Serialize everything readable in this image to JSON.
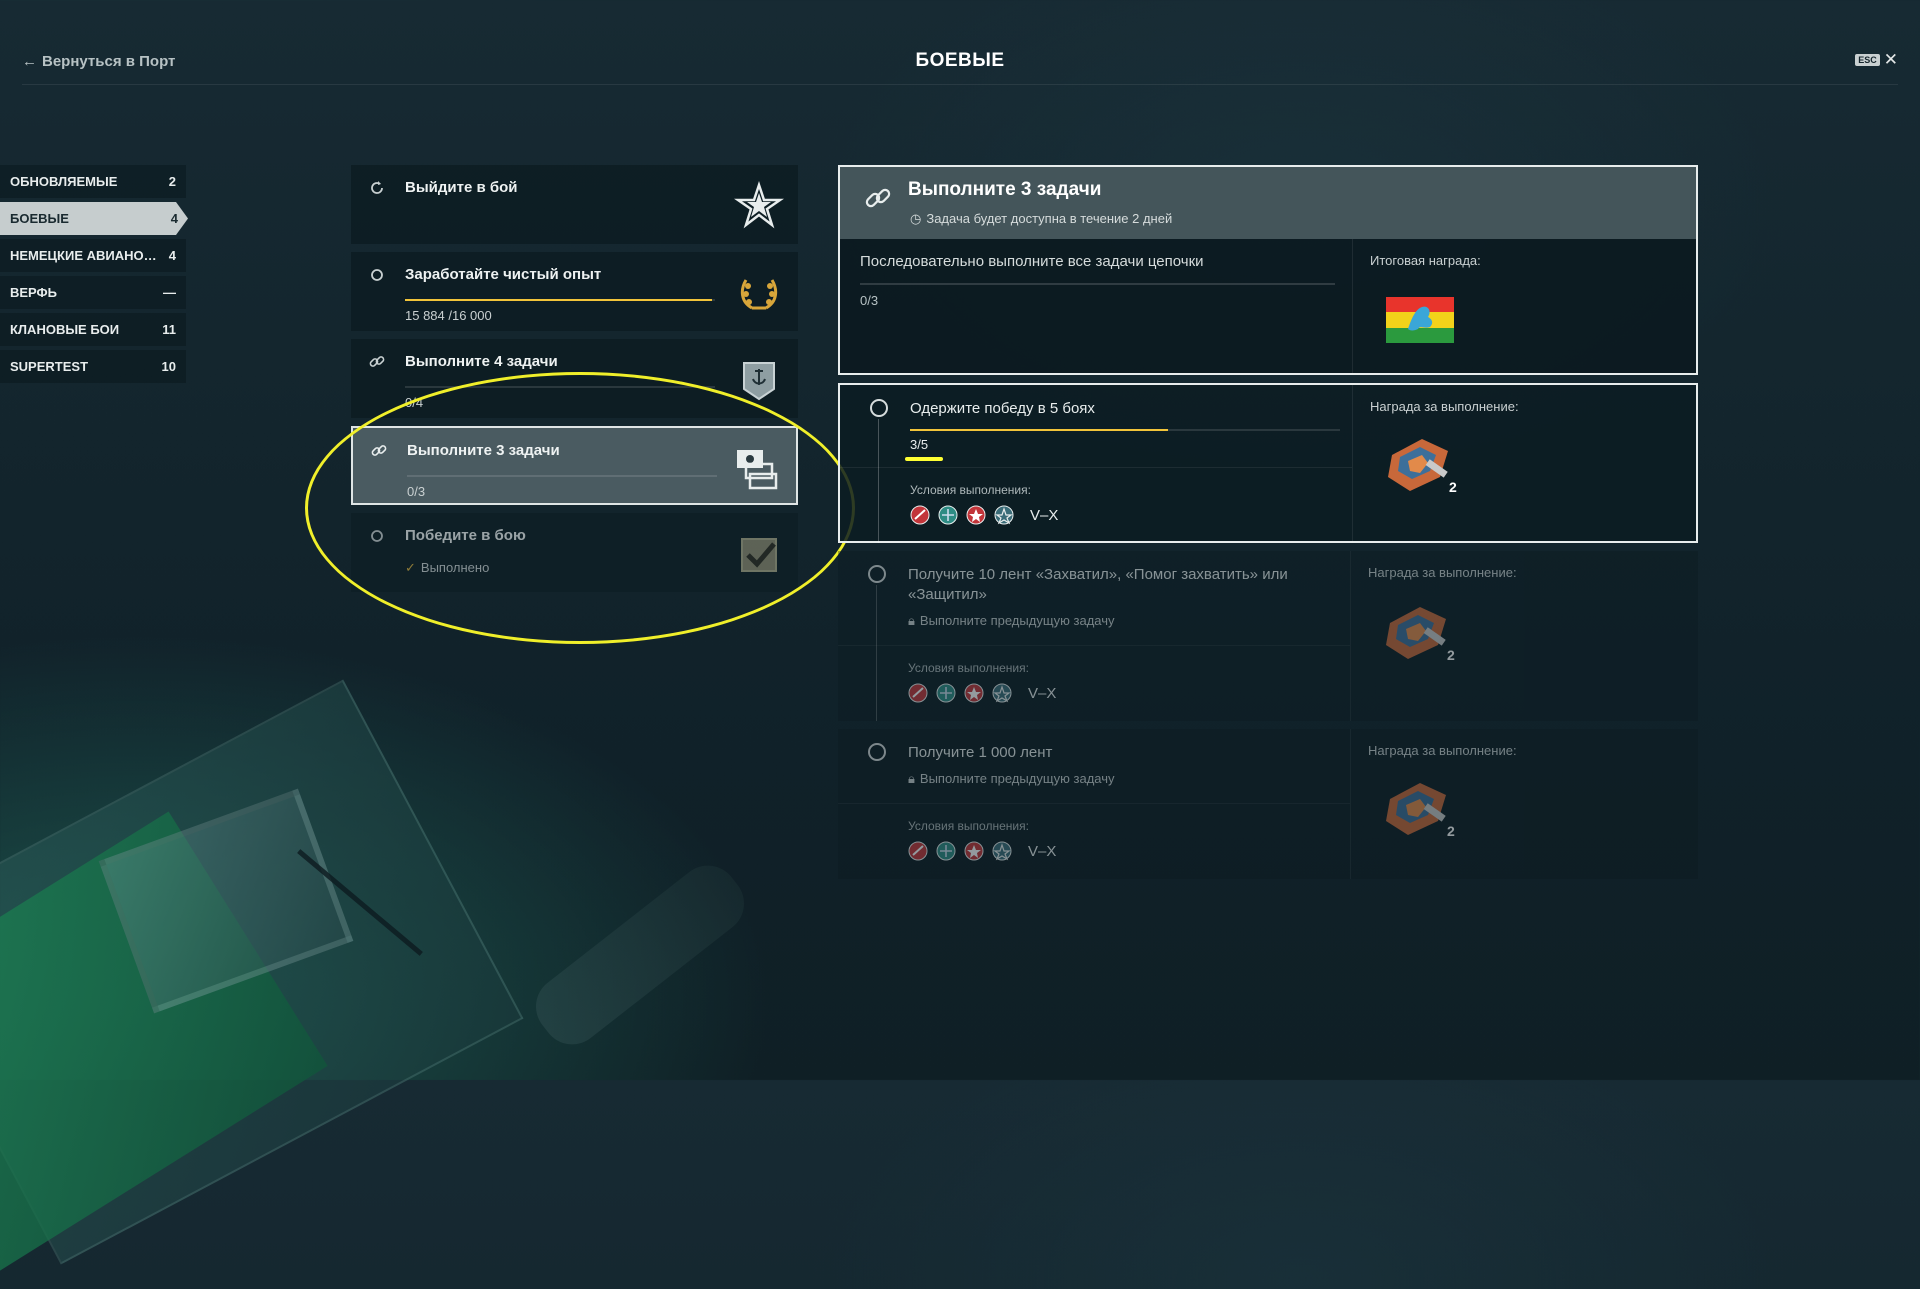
{
  "header": {
    "back_label": "Вернуться в Порт",
    "title": "БОЕВЫЕ",
    "esc_label": "ESC"
  },
  "categories": [
    {
      "label": "ОБНОВЛЯЕМЫЕ",
      "count": "2"
    },
    {
      "label": "БОЕВЫЕ",
      "count": "4"
    },
    {
      "label": "НЕМЕЦКИЕ АВИАНО…",
      "count": "4"
    },
    {
      "label": "ВЕРФЬ",
      "count": "—"
    },
    {
      "label": "КЛАНОВЫЕ БОИ",
      "count": "11"
    },
    {
      "label": "SUPERTEST",
      "count": "10"
    }
  ],
  "tasks": [
    {
      "title": "Выйдите в бой",
      "icon": "refresh-icon",
      "reward": "star-icon"
    },
    {
      "title": "Заработайте чистый опыт",
      "icon": "radio-icon",
      "progress": "15 884 /16 000",
      "progress_fraction": 0.99,
      "reward": "laurel-icon"
    },
    {
      "title": "Выполните 4 задачи",
      "icon": "link-icon",
      "progress": "0/4",
      "progress_fraction": 0,
      "reward": "anchor-badge-icon"
    },
    {
      "title": "Выполните 3 задачи",
      "icon": "link-icon",
      "progress": "0/3",
      "progress_fraction": 0,
      "reward": "containers-icon"
    },
    {
      "title": "Победите в бою",
      "icon": "radio-icon",
      "status": "Выполнено",
      "reward": "checkmark-icon"
    }
  ],
  "detail": {
    "title": "Выполните 3 задачи",
    "availability": "Задача будет доступна в течение 2 дней",
    "description": "Последовательно выполните все задачи цепочки",
    "progress": "0/3",
    "final_reward_label": "Итоговая награда:",
    "subtasks": [
      {
        "title": "Одержите победу в 5 боях",
        "progress": "3/5",
        "progress_fraction": 0.6,
        "conditions_label": "Условия выполнения:",
        "tier": "V–X",
        "reward_label": "Награда за выполнение:",
        "reward_count": "2"
      },
      {
        "title": "Получите 10 лент «Захватил», «Помог захватить» или «Защитил»",
        "locked_text": "Выполните предыдущую задачу",
        "conditions_label": "Условия выполнения:",
        "tier": "V–X",
        "reward_label": "Награда за выполнение:",
        "reward_count": "2"
      },
      {
        "title": "Получите 1 000 лент",
        "locked_text": "Выполните предыдущую задачу",
        "conditions_label": "Условия выполнения:",
        "tier": "V–X",
        "reward_label": "Награда за выполнение:",
        "reward_count": "2"
      }
    ]
  },
  "colors": {
    "accent": "#f2c43a",
    "annotation": "#f0ef2a",
    "panel": "#0b1a20",
    "selected_panel": "#4a5b61"
  }
}
